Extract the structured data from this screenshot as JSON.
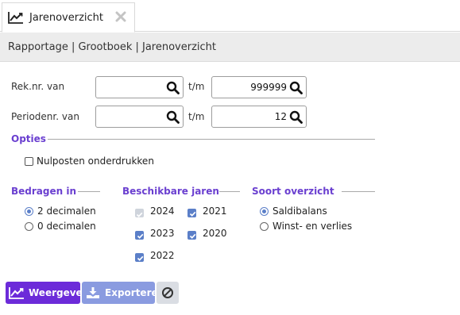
{
  "tab": {
    "title": "Jarenoverzicht",
    "icon": "line-chart-icon",
    "close_icon": "close-icon"
  },
  "breadcrumb": "Rapportage | Grootboek | Jarenoverzicht",
  "filters": {
    "rek_label": "Rek.nr. van",
    "rek_from_value": "",
    "tm_label": "t/m",
    "rek_to_value": "999999",
    "period_label": "Periodenr. van",
    "period_from_value": "",
    "period_to_value": "12"
  },
  "opties": {
    "title": "Opties",
    "nulposten_label": "Nulposten onderdrukken",
    "nulposten_checked": false
  },
  "bedragen": {
    "title": "Bedragen in",
    "options": [
      {
        "label": "2 decimalen",
        "selected": true
      },
      {
        "label": "0 decimalen",
        "selected": false
      }
    ]
  },
  "jaren": {
    "title": "Beschikbare jaren",
    "years": [
      {
        "label": "2024",
        "checked": true,
        "disabled": true
      },
      {
        "label": "2021",
        "checked": true,
        "disabled": false
      },
      {
        "label": "2023",
        "checked": true,
        "disabled": false
      },
      {
        "label": "2020",
        "checked": true,
        "disabled": false
      },
      {
        "label": "2022",
        "checked": true,
        "disabled": false
      }
    ]
  },
  "soort": {
    "title": "Soort overzicht",
    "options": [
      {
        "label": "Saldibalans",
        "selected": true
      },
      {
        "label": "Winst- en verlies",
        "selected": false
      }
    ]
  },
  "buttons": {
    "weergeven": "Weergeven",
    "exporteren": "Exporteren",
    "cancel_icon": "cancel-icon"
  },
  "colors": {
    "accent": "#6c2bd9",
    "section_title": "#6a3fd0",
    "checkbox": "#5b7fc8",
    "export_button": "#8a9be0"
  }
}
